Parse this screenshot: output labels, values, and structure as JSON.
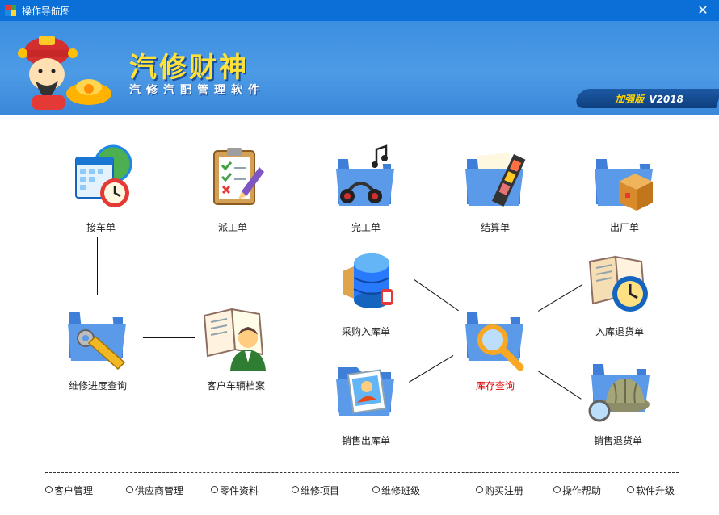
{
  "window": {
    "title": "操作导航图",
    "close_glyph": "✕"
  },
  "banner": {
    "brand": "汽修财神",
    "slogan": "汽修汽配管理软件",
    "edition_label": "加强版",
    "version": "V2018"
  },
  "nodes": {
    "reception": "接车单",
    "dispatch": "派工单",
    "completion": "完工单",
    "settlement": "结算单",
    "exit": "出厂单",
    "purchase_in": "采购入库单",
    "inbound_return": "入库退货单",
    "progress_query": "维修进度查询",
    "vehicle_archive": "客户车辆档案",
    "inventory_query": "库存查询",
    "sales_out": "销售出库单",
    "sales_return": "销售退货单"
  },
  "bottom_links": [
    "客户管理",
    "供应商管理",
    "零件资料",
    "维修项目",
    "维修班级",
    "购买注册",
    "操作帮助",
    "软件升级"
  ],
  "colors": {
    "titlebar": "#0a6fd6",
    "banner": "#4d9be6",
    "brand_text": "#ffe13a",
    "highlight_label": "#e00000"
  }
}
